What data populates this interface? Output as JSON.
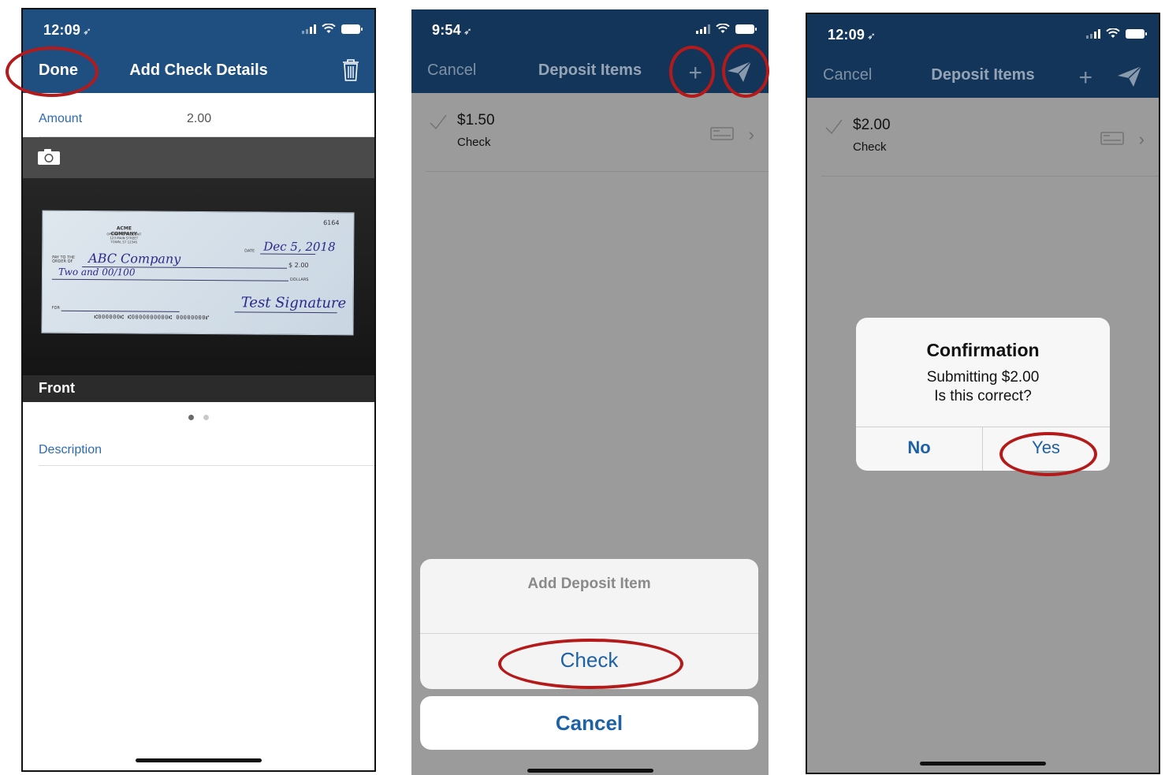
{
  "screen1": {
    "time": "12:09",
    "done_label": "Done",
    "title": "Add Check Details",
    "amount_label": "Amount",
    "amount_value": "2.00",
    "photo_side": "Front",
    "description_label": "Description",
    "check_image": {
      "company": "ACME COMPANY",
      "company_line2": "OPERATING ACCOUNT",
      "company_line3": "123 MAIN STREET",
      "company_line4": "TOWN, ST 12345",
      "check_number": "6164",
      "date_label": "DATE",
      "date_value": "Dec 5, 2018",
      "pay_to_label": "PAY TO THE ORDER OF",
      "payee": "ABC Company",
      "amount_box": "$ 2.00",
      "written_amount": "Two and 00/100",
      "dollars_label": "DOLLARS",
      "for_label": "FOR",
      "signature": "Test Signature",
      "micr": "⑆000000⑆ ⑆0000000000⑆ 00000000⑈"
    }
  },
  "screen2": {
    "time": "9:54",
    "cancel_label": "Cancel",
    "title": "Deposit Items",
    "item_amount": "$1.50",
    "item_type": "Check",
    "sheet_title": "Add Deposit Item",
    "sheet_action": "Check",
    "sheet_cancel": "Cancel"
  },
  "screen3": {
    "time": "12:09",
    "cancel_label": "Cancel",
    "title": "Deposit Items",
    "item_amount": "$2.00",
    "item_type": "Check",
    "alert_title": "Confirmation",
    "alert_line1": "Submitting $2.00",
    "alert_line2": "Is this correct?",
    "alert_no": "No",
    "alert_yes": "Yes"
  },
  "icons": {
    "location": "location-arrow-icon",
    "signal": "cellular-signal-icon",
    "wifi": "wifi-icon",
    "battery": "battery-icon",
    "trash": "trash-icon",
    "camera": "camera-icon",
    "plus": "plus-icon",
    "send": "send-icon",
    "check": "checkmark-icon",
    "card": "check-card-icon",
    "chevron": "chevron-right-icon"
  },
  "colors": {
    "nav_blue": "#1e4f80",
    "nav_blue_dimmed": "#13355a",
    "link_blue": "#1e62a5",
    "label_blue": "#2a6cb0",
    "overlay_gray": "#9b9b9b",
    "annotation_red": "#b41a1a"
  }
}
